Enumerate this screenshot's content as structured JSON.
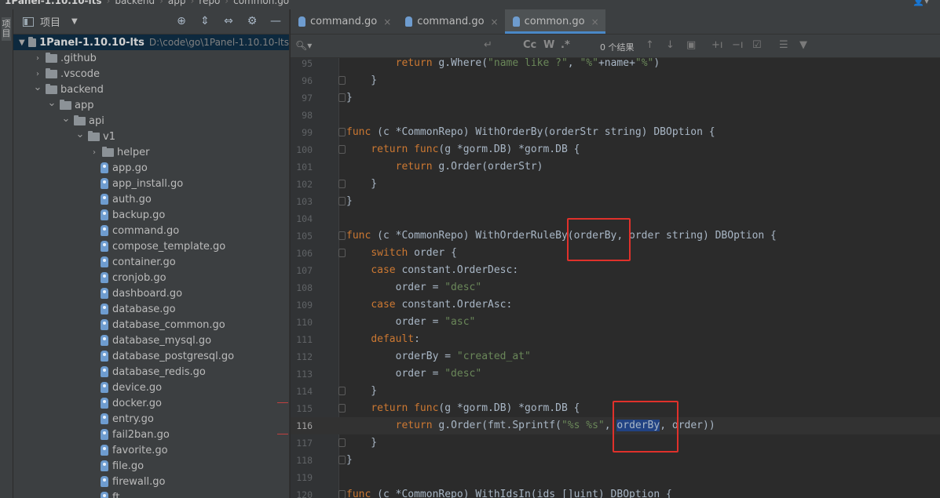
{
  "breadcrumb": {
    "root": "1Panel-1.10.10-lts",
    "items": [
      "backend",
      "app",
      "repo",
      "common.go"
    ]
  },
  "toolstrip": {
    "label": "项目"
  },
  "project_panel": {
    "title": "项目",
    "root_name": "1Panel-1.10.10-lts",
    "root_path": "D:\\code\\go\\1Panel-1.10.10-lts",
    "tree": [
      {
        "label": ".github",
        "depth": 1,
        "kind": "folder",
        "expanded": false
      },
      {
        "label": ".vscode",
        "depth": 1,
        "kind": "folder",
        "expanded": false
      },
      {
        "label": "backend",
        "depth": 1,
        "kind": "folder",
        "expanded": true
      },
      {
        "label": "app",
        "depth": 2,
        "kind": "folder",
        "expanded": true
      },
      {
        "label": "api",
        "depth": 3,
        "kind": "folder",
        "expanded": true
      },
      {
        "label": "v1",
        "depth": 4,
        "kind": "folder",
        "expanded": true
      },
      {
        "label": "helper",
        "depth": 5,
        "kind": "folder",
        "expanded": false
      },
      {
        "label": "app.go",
        "depth": 5,
        "kind": "go"
      },
      {
        "label": "app_install.go",
        "depth": 5,
        "kind": "go"
      },
      {
        "label": "auth.go",
        "depth": 5,
        "kind": "go"
      },
      {
        "label": "backup.go",
        "depth": 5,
        "kind": "go"
      },
      {
        "label": "command.go",
        "depth": 5,
        "kind": "go"
      },
      {
        "label": "compose_template.go",
        "depth": 5,
        "kind": "go"
      },
      {
        "label": "container.go",
        "depth": 5,
        "kind": "go"
      },
      {
        "label": "cronjob.go",
        "depth": 5,
        "kind": "go"
      },
      {
        "label": "dashboard.go",
        "depth": 5,
        "kind": "go"
      },
      {
        "label": "database.go",
        "depth": 5,
        "kind": "go"
      },
      {
        "label": "database_common.go",
        "depth": 5,
        "kind": "go"
      },
      {
        "label": "database_mysql.go",
        "depth": 5,
        "kind": "go"
      },
      {
        "label": "database_postgresql.go",
        "depth": 5,
        "kind": "go"
      },
      {
        "label": "database_redis.go",
        "depth": 5,
        "kind": "go"
      },
      {
        "label": "device.go",
        "depth": 5,
        "kind": "go"
      },
      {
        "label": "docker.go",
        "depth": 5,
        "kind": "go"
      },
      {
        "label": "entry.go",
        "depth": 5,
        "kind": "go"
      },
      {
        "label": "fail2ban.go",
        "depth": 5,
        "kind": "go"
      },
      {
        "label": "favorite.go",
        "depth": 5,
        "kind": "go"
      },
      {
        "label": "file.go",
        "depth": 5,
        "kind": "go"
      },
      {
        "label": "firewall.go",
        "depth": 5,
        "kind": "go"
      },
      {
        "label": "ft...",
        "depth": 5,
        "kind": "go"
      }
    ]
  },
  "tabs": [
    {
      "label": "command.go",
      "active": false
    },
    {
      "label": "command.go",
      "active": false
    },
    {
      "label": "common.go",
      "active": true
    }
  ],
  "findbar": {
    "search_icon": "Q",
    "options": [
      "Cc",
      "W",
      ".*"
    ],
    "results": "0 个结果"
  },
  "code": {
    "current_line": 116,
    "lines": [
      {
        "n": "95",
        "html": "        <span class='kw'>return</span> g.Where(<span class='str'>\"name like ?\"</span>, <span class='str'>\"%\"</span>+name+<span class='str'>\"%\"</span>)"
      },
      {
        "n": "96",
        "html": "    }"
      },
      {
        "n": "97",
        "html": "}"
      },
      {
        "n": "98",
        "html": ""
      },
      {
        "n": "99",
        "html": "<span class='kw'>func</span> (c *CommonRepo) WithOrderBy(orderStr string) DBOption {"
      },
      {
        "n": "100",
        "html": "    <span class='kw'>return</span> <span class='kw'>func</span>(g *gorm.DB) *gorm.DB {"
      },
      {
        "n": "101",
        "html": "        <span class='kw'>return</span> g.Order(orderStr)"
      },
      {
        "n": "102",
        "html": "    }"
      },
      {
        "n": "103",
        "html": "}"
      },
      {
        "n": "104",
        "html": ""
      },
      {
        "n": "105",
        "html": "<span class='kw'>func</span> (c *CommonRepo) WithOrderRuleBy(orderBy, order string) DBOption {"
      },
      {
        "n": "106",
        "html": "    <span class='kw'>switch</span> order {"
      },
      {
        "n": "107",
        "html": "    <span class='kw'>case</span> constant.OrderDesc:"
      },
      {
        "n": "108",
        "html": "        order = <span class='str'>\"desc\"</span>"
      },
      {
        "n": "109",
        "html": "    <span class='kw'>case</span> constant.OrderAsc:"
      },
      {
        "n": "110",
        "html": "        order = <span class='str'>\"asc\"</span>"
      },
      {
        "n": "111",
        "html": "    <span class='kw'>default</span>:"
      },
      {
        "n": "112",
        "html": "        orderBy = <span class='str'>\"created_at\"</span>"
      },
      {
        "n": "113",
        "html": "        order = <span class='str'>\"desc\"</span>"
      },
      {
        "n": "114",
        "html": "    }"
      },
      {
        "n": "115",
        "html": "    <span class='kw'>return</span> <span class='kw'>func</span>(g *gorm.DB) *gorm.DB {"
      },
      {
        "n": "116",
        "html": "        <span class='kw'>return</span> g.Order(fmt.Sprintf(<span class='str'>\"%s %s\"</span>, <span class='sel'>orderBy</span>, order))"
      },
      {
        "n": "117",
        "html": "    }"
      },
      {
        "n": "118",
        "html": "}"
      },
      {
        "n": "119",
        "html": ""
      },
      {
        "n": "120",
        "html": "<span class='kw'>func</span> (c *CommonRepo) WithIdsIn(ids []uint) DBOption {"
      }
    ]
  },
  "colors": {
    "highlight_box": "#e0312b",
    "tab_accent": "#4a88c7",
    "keyword": "#cc7832",
    "string": "#6a8759"
  }
}
